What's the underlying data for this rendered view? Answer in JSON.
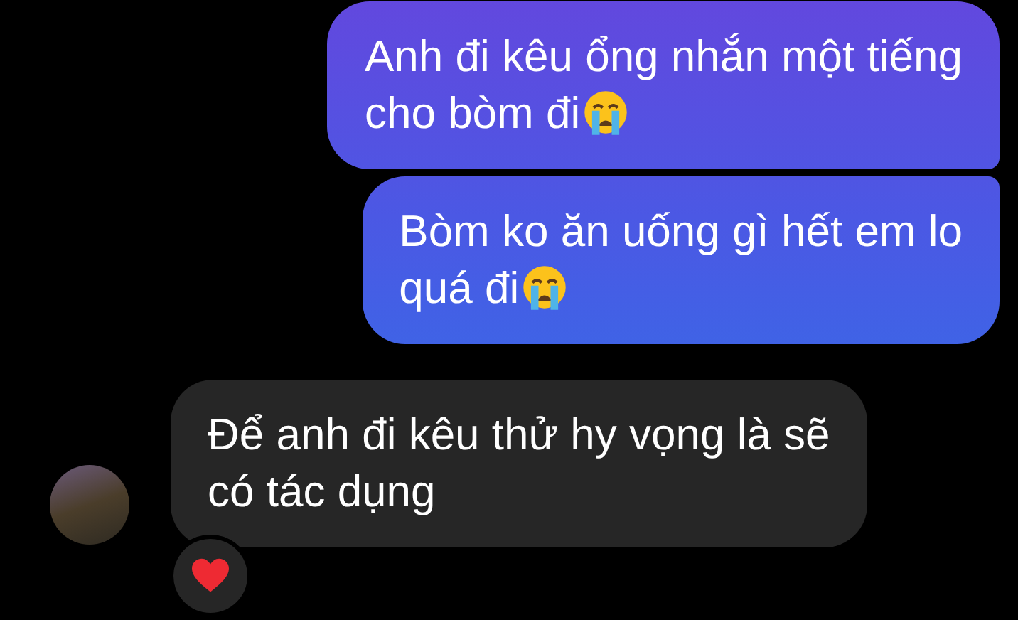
{
  "messages": [
    {
      "kind": "sent",
      "lines": [
        "Anh đi kêu ổng nhắn một tiếng",
        "cho bòm đi"
      ],
      "crying_emoji": true
    },
    {
      "kind": "sent",
      "lines": [
        "Bòm ko ăn uống gì hết em lo",
        "quá đi"
      ],
      "crying_emoji": true
    },
    {
      "kind": "received",
      "lines": [
        "Để anh đi kêu thử hy vọng là sẽ",
        "có tác dụng"
      ],
      "heart_reaction": true
    }
  ]
}
